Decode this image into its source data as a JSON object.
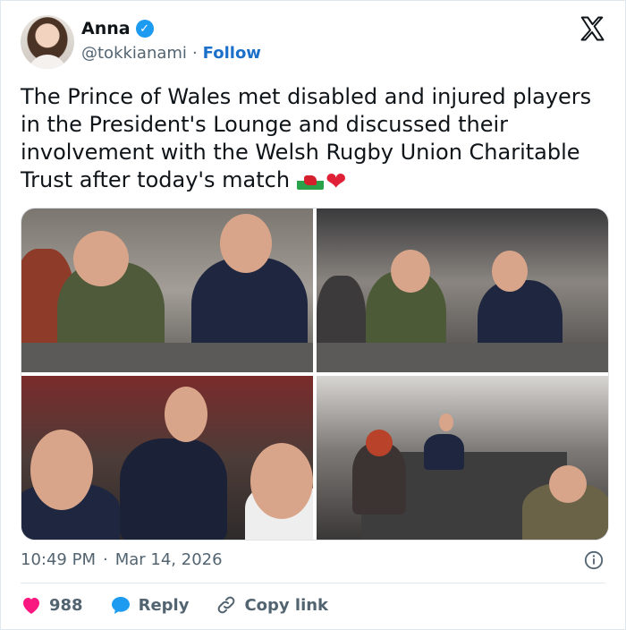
{
  "author": {
    "name": "Anna",
    "handle": "@tokkianami",
    "separator": "·",
    "follow_label": "Follow",
    "avatar_icon": "profile-photo"
  },
  "platform_icon": "x-logo-icon",
  "tweet": {
    "text": "The Prince of Wales met disabled and injured players in the President's Lounge and discussed their involvement with the Welsh Rugby Union Charitable Trust after today's match",
    "emoji": [
      "wales-flag-emoji",
      "red-heart-emoji"
    ]
  },
  "media": {
    "count": 4,
    "photos": [
      "photo-1",
      "photo-2",
      "photo-3",
      "photo-4"
    ]
  },
  "meta": {
    "time": "10:49 PM",
    "separator": "·",
    "date": "Mar 14, 2026"
  },
  "actions": {
    "like_count": "988",
    "reply_label": "Reply",
    "copy_link_label": "Copy link"
  },
  "colors": {
    "accent": "#1d9bf0",
    "follow": "#1d70c9",
    "like": "#f91880",
    "reply": "#1d9bf0",
    "text_secondary": "#536471"
  }
}
